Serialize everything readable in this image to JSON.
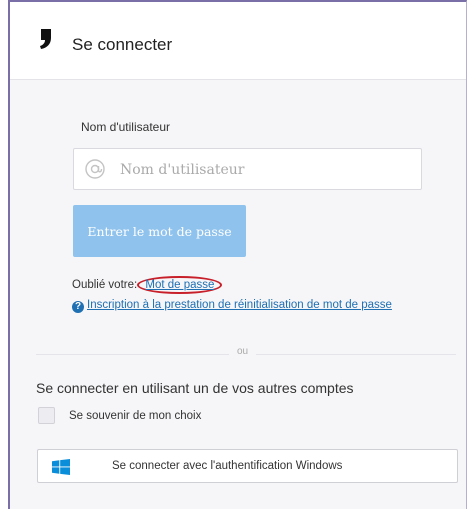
{
  "header": {
    "title": "Se connecter"
  },
  "login": {
    "username_label": "Nom d'utilisateur",
    "username_placeholder": "Nom d'utilisateur",
    "submit_label": "Entrer le mot de passe"
  },
  "forgot": {
    "prefix": "Oublié votre:",
    "link": "Mot de passe"
  },
  "reset_link": "Inscription à la prestation de réinitialisation de mot de passe",
  "divider_text": "ou",
  "other_accounts": {
    "heading": "Se connecter en utilisant un de vos autres comptes",
    "remember_label": "Se souvenir de mon choix",
    "windows_button": "Se connecter avec l'authentification Windows"
  },
  "colors": {
    "accent": "#1f6fb3",
    "primary_button": "#8fc2ec",
    "highlight": "#c8202a",
    "windows_blue": "#0a8ed9"
  }
}
